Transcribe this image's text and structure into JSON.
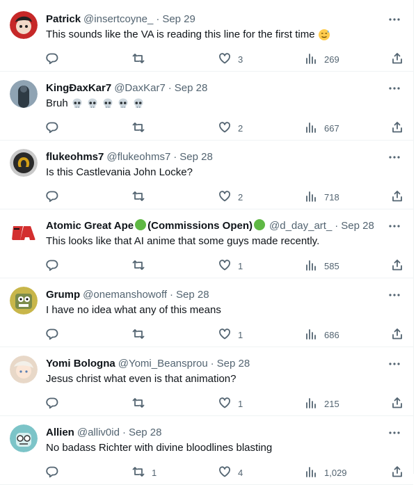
{
  "tweets": [
    {
      "name": "Patrick",
      "handle": "@insertcoyne_",
      "sep": "·",
      "date": "Sep 29",
      "text": "This sounds like the VA is reading this line for the first time",
      "emoji": "sweat-smile",
      "replies": "",
      "retweets": "",
      "likes": "3",
      "views": "269",
      "avatar_color": "#c62828"
    },
    {
      "name": "KingÐaxKar7",
      "handle": "@DaxKar7",
      "sep": "·",
      "date": "Sep 28",
      "text": "Bruh",
      "emoji": "skulls-5",
      "replies": "",
      "retweets": "",
      "likes": "2",
      "views": "667",
      "avatar_color": "#4a5a6a"
    },
    {
      "name": "flukeohms7",
      "handle": "@flukeohms7",
      "sep": "·",
      "date": "Sep 28",
      "text": "Is this Castlevania John Locke?",
      "emoji": "",
      "replies": "",
      "retweets": "",
      "likes": "2",
      "views": "718",
      "avatar_color": "#3a3a3a"
    },
    {
      "name": "Atomic Great Ape",
      "name_suffix": "(Commissions Open)",
      "handle": "@d_day_art_",
      "sep": "·",
      "date": "Sep 28",
      "text": "This looks like that AI anime that some guys made recently.",
      "emoji": "",
      "replies": "",
      "retweets": "",
      "likes": "1",
      "views": "585",
      "avatar_color": "#d32f2f"
    },
    {
      "name": "Grump",
      "handle": "@onemanshowoff",
      "sep": "·",
      "date": "Sep 28",
      "text": "I have no idea what any of this means",
      "emoji": "",
      "replies": "",
      "retweets": "",
      "likes": "1",
      "views": "686",
      "avatar_color": "#c8b64a"
    },
    {
      "name": "Yomi Bologna",
      "handle": "@Yomi_Beansprou",
      "sep": "·",
      "date": "Sep 28",
      "text": "Jesus christ what even is that animation?",
      "emoji": "",
      "replies": "",
      "retweets": "",
      "likes": "1",
      "views": "215",
      "avatar_color": "#e8d8c8"
    },
    {
      "name": "Allien",
      "handle": "@alliv0id",
      "sep": "·",
      "date": "Sep 28",
      "text": "No badass Richter with divine bloodlines blasting",
      "emoji": "",
      "replies": "",
      "retweets": "1",
      "likes": "4",
      "views": "1,029",
      "avatar_color": "#7cc4c8"
    }
  ]
}
